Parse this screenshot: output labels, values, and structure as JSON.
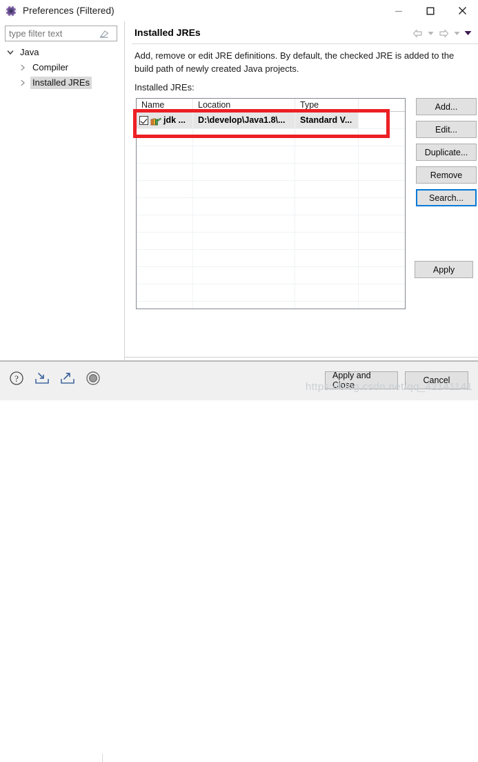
{
  "window": {
    "title": "Preferences (Filtered)",
    "icon": "preferences-gear-icon",
    "minimize_label": "—",
    "maximize_label": "□",
    "close_label": "✕"
  },
  "sidebar": {
    "filter": {
      "value": "",
      "placeholder": "type filter text",
      "clear_icon": "eraser-icon"
    },
    "tree": [
      {
        "label": "Java",
        "level": 1,
        "expanded": true,
        "selected": false
      },
      {
        "label": "Compiler",
        "level": 2,
        "expanded": false,
        "selected": false
      },
      {
        "label": "Installed JREs",
        "level": 2,
        "expanded": false,
        "selected": true
      }
    ]
  },
  "main": {
    "title": "Installed JREs",
    "description": "Add, remove or edit JRE definitions. By default, the checked JRE is added to the build path of newly created Java projects.",
    "list_label": "Installed JREs:",
    "nav": {
      "back_icon": "arrow-left-icon",
      "back_menu_icon": "caret-down-icon",
      "forward_icon": "arrow-right-icon",
      "forward_menu_icon": "caret-down-icon",
      "view_menu_icon": "caret-down-filled-icon"
    },
    "table": {
      "columns": [
        "Name",
        "Location",
        "Type",
        ""
      ],
      "rows": [
        {
          "checked": true,
          "icon": "jre-library-icon",
          "name": "jdk ...",
          "location": "D:\\develop\\Java1.8\\...",
          "type": "Standard V...",
          "extra": ""
        }
      ],
      "empty_row_count": 11
    },
    "side_buttons": [
      {
        "label": "Add...",
        "focused": false
      },
      {
        "label": "Edit...",
        "focused": false
      },
      {
        "label": "Duplicate...",
        "focused": false
      },
      {
        "label": "Remove",
        "focused": false
      },
      {
        "label": "Search...",
        "focused": true
      }
    ],
    "apply_button": "Apply"
  },
  "footer": {
    "icons": [
      {
        "name": "help-icon",
        "title": "?"
      },
      {
        "name": "import-icon",
        "title": "Import"
      },
      {
        "name": "export-icon",
        "title": "Export"
      },
      {
        "name": "restore-defaults-icon",
        "title": "Restore"
      }
    ],
    "buttons": [
      {
        "label": "Apply and Close",
        "variant": "wide"
      },
      {
        "label": "Cancel",
        "variant": "narrow"
      }
    ]
  },
  "watermark": "https://blog.csdn.net/qq_42141141",
  "colors": {
    "accent": "#0078d7",
    "annotation": "#ec2024",
    "selection": "#d9d9d9",
    "row_fill": "#e6e6e6"
  }
}
